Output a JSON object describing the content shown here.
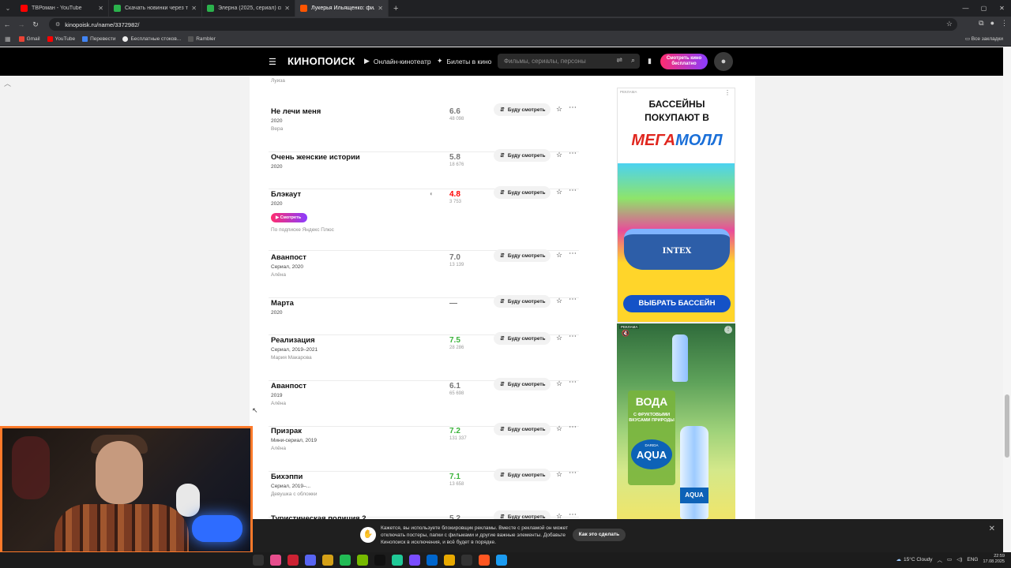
{
  "browser": {
    "tabs": [
      {
        "title": "ТВРоман - YouTube",
        "color": "#ff0000",
        "active": false
      },
      {
        "title": "Скачать новинки через торрент",
        "color": "#2bb24c",
        "active": false
      },
      {
        "title": "Элерна (2025, сериал) скачать",
        "color": "#2bb24c",
        "active": false
      },
      {
        "title": "Лукерья Ильященко: фильмы",
        "color": "#ff5500",
        "active": true
      }
    ],
    "url": "kinopoisk.ru/name/3372982/",
    "bookmarks": [
      "Gmail",
      "YouTube",
      "Перевести",
      "Бесплатные стоков...",
      "Rambler"
    ],
    "all_bookmarks": "Все закладки"
  },
  "header": {
    "logo": "КИНОПОИСК",
    "nav": [
      "Онлайн-кинотеатр",
      "Билеты в кино"
    ],
    "search_placeholder": "Фильмы, сериалы, персоны",
    "watch_line1": "Смотреть кино",
    "watch_line2": "бесплатно"
  },
  "filmography": {
    "want_label": "Буду смотреть",
    "watch_label": "Смотреть",
    "prev_role": "Луиза",
    "items": [
      {
        "title": "Не лечи меня",
        "meta": "2020",
        "role": "Вера",
        "rating": "6.6",
        "votes": "48 098",
        "rating_color": "grey"
      },
      {
        "title": "Очень женские истории",
        "meta": "2020",
        "role": "",
        "rating": "5.8",
        "votes": "18 676",
        "rating_color": "grey"
      },
      {
        "title": "Блэкаут",
        "meta": "2020",
        "role": "",
        "rating": "4.8",
        "votes": "3 753",
        "rating_color": "red",
        "subscription": "По подписке Яндекс Плюс"
      },
      {
        "title": "Аванпост",
        "meta": "Сериал, 2020",
        "role": "Алёна",
        "rating": "7.0",
        "votes": "13 139",
        "rating_color": "grey"
      },
      {
        "title": "Марта",
        "meta": "2020",
        "role": "",
        "rating": "—",
        "votes": "",
        "rating_color": "grey"
      },
      {
        "title": "Реализация",
        "meta": "Сериал, 2019–2021",
        "role": "Мария Макарова",
        "rating": "7.5",
        "votes": "28 286",
        "rating_color": "green"
      },
      {
        "title": "Аванпост",
        "meta": "2019",
        "role": "Алёна",
        "rating": "6.1",
        "votes": "65 698",
        "rating_color": "grey"
      },
      {
        "title": "Призрак",
        "meta": "Мини-сериал, 2019",
        "role": "Алёна",
        "rating": "7.2",
        "votes": "131 337",
        "rating_color": "green"
      },
      {
        "title": "Бихэппи",
        "meta": "Сериал, 2019–...",
        "role": "Девушка с обложки",
        "rating": "7.1",
        "votes": "13 658",
        "rating_color": "green"
      },
      {
        "title": "Туристическая полиция 2",
        "meta": "",
        "role": "",
        "rating": "5.2",
        "votes": "",
        "rating_color": "grey"
      }
    ]
  },
  "ads": {
    "label": "РЕКЛАМА",
    "ad1_line1": "БАССЕЙНЫ",
    "ad1_line2": "ПОКУПАЮТ В",
    "ad1_brand_a": "МЕГА",
    "ad1_brand_b": "МОЛЛ",
    "ad1_pool": "INTEX",
    "ad1_button": "ВЫБРАТЬ БАССЕЙН",
    "ad2_title": "ВОДА",
    "ad2_sub": "С ФРУКТОВЫМИ ВКУСАМИ ПРИРОДЫ",
    "ad2_brand_top": "DARIDA",
    "ad2_brand": "AQUA"
  },
  "notice": {
    "text": "Кажется, вы используете блокировщик рекламы. Вместе с рекламой он может отключать постеры, папки с фильмами и другие важные элементы. Добавьте Кинопоиск в исключения, и всё будет в порядке.",
    "button": "Как это сделать"
  },
  "taskbar": {
    "weather": "15°C Cloudy",
    "lang": "ENG",
    "time": "22:59",
    "date": "17.08.2025"
  }
}
